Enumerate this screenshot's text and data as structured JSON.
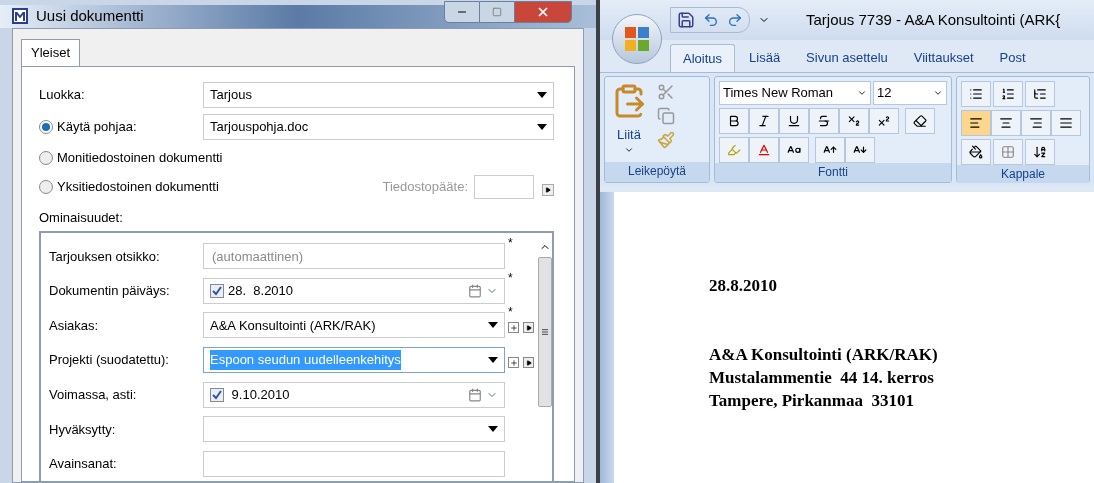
{
  "dialog": {
    "title": "Uusi dokumentti",
    "tabs": [
      {
        "label": "Yleiset",
        "selected": true
      }
    ],
    "fields": [
      {
        "kind": "dropdown",
        "label": "Luokka:",
        "value": "Tarjous"
      },
      {
        "kind": "radio-dropdown",
        "label": "Käytä pohjaa:",
        "selected": true,
        "value": "Tarjouspohja.doc"
      },
      {
        "kind": "radio",
        "label": "Monitiedostoinen dokumentti",
        "selected": false
      },
      {
        "kind": "radio-extension",
        "label": "Yksitiedostoinen dokumentti",
        "selected": false,
        "extension_label": "Tiedostopääte:"
      }
    ],
    "properties_label": "Ominaisuudet:",
    "required_mark": "*",
    "properties": [
      {
        "kind": "text",
        "label": "Tarjouksen otsikko:",
        "placeholder": "(automaattinen)",
        "required": true
      },
      {
        "kind": "date",
        "label": "Dokumentin päiväys:",
        "checked": true,
        "value": "28.  8.2010",
        "required": true
      },
      {
        "kind": "dropdown",
        "label": "Asiakas:",
        "value": "A&A Konsultointi (ARK/RAK)",
        "required": true,
        "highlighted": false,
        "extra_buttons": true
      },
      {
        "kind": "dropdown",
        "label": "Projekti (suodatettu):",
        "value": "Espoon seudun uudelleenkehitys",
        "required": false,
        "highlighted": true,
        "extra_buttons": true
      },
      {
        "kind": "date",
        "label": "Voimassa, asti:",
        "checked": true,
        "value": " 9.10.2010",
        "required": false
      },
      {
        "kind": "dropdown",
        "label": "Hyväksytty:",
        "required": false,
        "highlighted": false,
        "extra_buttons": false
      },
      {
        "kind": "text",
        "label": "Avainsanat:",
        "required": false
      }
    ]
  },
  "word": {
    "title": "Tarjous 7739 - A&A Konsultointi (ARK{",
    "tabs": [
      {
        "label": "Aloitus",
        "selected": true
      },
      {
        "label": "Lisää",
        "selected": false
      },
      {
        "label": "Sivun asettelu",
        "selected": false
      },
      {
        "label": "Viittaukset",
        "selected": false
      },
      {
        "label": "Post",
        "selected": false
      }
    ],
    "paste_label": "Liitä",
    "font_name": "Times New Roman",
    "font_size": "12",
    "groups": [
      "Leikepöytä",
      "Fontti",
      "Kappale"
    ],
    "alignments": [
      {
        "selected": true
      },
      {
        "selected": false
      },
      {
        "selected": false
      },
      {
        "selected": false
      }
    ],
    "document": {
      "date": "28.8.2010",
      "address": [
        "A&A Konsultointi (ARK/RAK)",
        "Mustalammentie  44 14. kerros",
        "Tampere, Pirkanmaa  33101"
      ]
    }
  }
}
